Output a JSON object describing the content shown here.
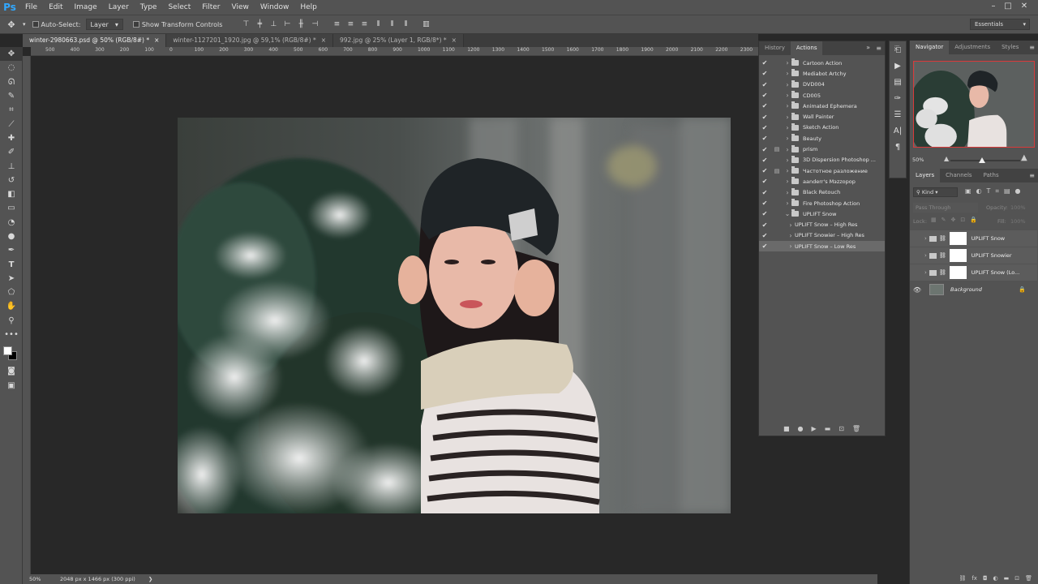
{
  "app": {
    "logo": "Ps"
  },
  "menu": [
    "File",
    "Edit",
    "Image",
    "Layer",
    "Type",
    "Select",
    "Filter",
    "View",
    "Window",
    "Help"
  ],
  "options_bar": {
    "auto_select_label": "Auto-Select:",
    "auto_select_value": "Layer",
    "show_transform_label": "Show Transform Controls",
    "workspace": "Essentials"
  },
  "doc_tabs": [
    {
      "label": "winter-2980663.psd @ 50% (RGB/8#) *",
      "active": true
    },
    {
      "label": "winter-1127201_1920.jpg @ 59,1% (RGB/8#) *",
      "active": false
    },
    {
      "label": "992.jpg @ 25% (Layer 1, RGB/8*) *",
      "active": false
    }
  ],
  "ruler_top": [
    "500",
    "400",
    "300",
    "200",
    "100",
    "0",
    "100",
    "200",
    "300",
    "400",
    "500",
    "600",
    "700",
    "800",
    "900",
    "1000",
    "1100",
    "1200",
    "1300",
    "1400",
    "1500",
    "1600",
    "1700",
    "1800",
    "1900",
    "2000",
    "2100",
    "2200",
    "2300",
    "2400",
    "2500"
  ],
  "status": {
    "zoom": "50%",
    "doc_info": "2048 px x 1466 px (300 ppi)"
  },
  "actions_panel": {
    "tabs": [
      "History",
      "Actions"
    ],
    "active_tab": "Actions",
    "items": [
      {
        "label": "Cartoon Action",
        "dialog": false,
        "expanded": false,
        "indent": 0
      },
      {
        "label": "Mediabot Artchy",
        "dialog": false,
        "expanded": false,
        "indent": 0
      },
      {
        "label": "DVD004",
        "dialog": false,
        "expanded": false,
        "indent": 0
      },
      {
        "label": "CD005",
        "dialog": false,
        "expanded": false,
        "indent": 0
      },
      {
        "label": "Animated Ephemera",
        "dialog": false,
        "expanded": false,
        "indent": 0
      },
      {
        "label": "Wall Painter",
        "dialog": false,
        "expanded": false,
        "indent": 0
      },
      {
        "label": "Sketch Action",
        "dialog": false,
        "expanded": false,
        "indent": 0
      },
      {
        "label": "Beauty",
        "dialog": false,
        "expanded": false,
        "indent": 0
      },
      {
        "label": "prism",
        "dialog": true,
        "expanded": false,
        "indent": 0
      },
      {
        "label": "3D Dispersion Photoshop ...",
        "dialog": false,
        "expanded": false,
        "indent": 0
      },
      {
        "label": "Частотное разложение",
        "dialog": true,
        "expanded": false,
        "indent": 0
      },
      {
        "label": "aanderr's Мэzzорор",
        "dialog": false,
        "expanded": false,
        "indent": 0
      },
      {
        "label": "Black Retouch",
        "dialog": false,
        "expanded": false,
        "indent": 0
      },
      {
        "label": "Fire Photoshop Action",
        "dialog": false,
        "expanded": false,
        "indent": 0
      },
      {
        "label": "UPLIFT Snow",
        "dialog": false,
        "expanded": true,
        "indent": 0
      },
      {
        "label": "UPLIFT Snow – High Res",
        "dialog": false,
        "expanded": false,
        "indent": 1
      },
      {
        "label": "UPLIFT Snowier – High Res",
        "dialog": false,
        "expanded": false,
        "indent": 1
      },
      {
        "label": "UPLIFT Snow – Low Res",
        "dialog": false,
        "expanded": false,
        "indent": 1,
        "selected": true
      }
    ]
  },
  "navigator": {
    "tabs": [
      "Navigator",
      "Adjustments",
      "Styles"
    ],
    "zoom": "50%"
  },
  "layers": {
    "tabs": [
      "Layers",
      "Channels",
      "Paths"
    ],
    "filter_kind": "Kind",
    "blend_mode": "Pass Through",
    "opacity_label": "Opacity:",
    "opacity_value": "100%",
    "lock_label": "Lock:",
    "fill_label": "Fill:",
    "fill_value": "100%",
    "items": [
      {
        "name": "UPLIFT Snow",
        "type": "group",
        "visible": false
      },
      {
        "name": "UPLIFT Snowier",
        "type": "group",
        "visible": false
      },
      {
        "name": "UPLIFT Snow (Lo...",
        "type": "group",
        "visible": false
      },
      {
        "name": "Background",
        "type": "image",
        "visible": true,
        "locked": true
      }
    ]
  },
  "icons": {
    "tools": [
      "move-icon",
      "marquee-icon",
      "lasso-icon",
      "quick-select-icon",
      "crop-icon",
      "eyedropper-icon",
      "healing-icon",
      "brush-icon",
      "stamp-icon",
      "history-brush-icon",
      "eraser-icon",
      "gradient-icon",
      "blur-icon",
      "dodge-icon",
      "pen-icon",
      "type-icon",
      "path-select-icon",
      "shape-icon",
      "hand-icon",
      "zoom-icon",
      "more-tools-icon"
    ]
  }
}
